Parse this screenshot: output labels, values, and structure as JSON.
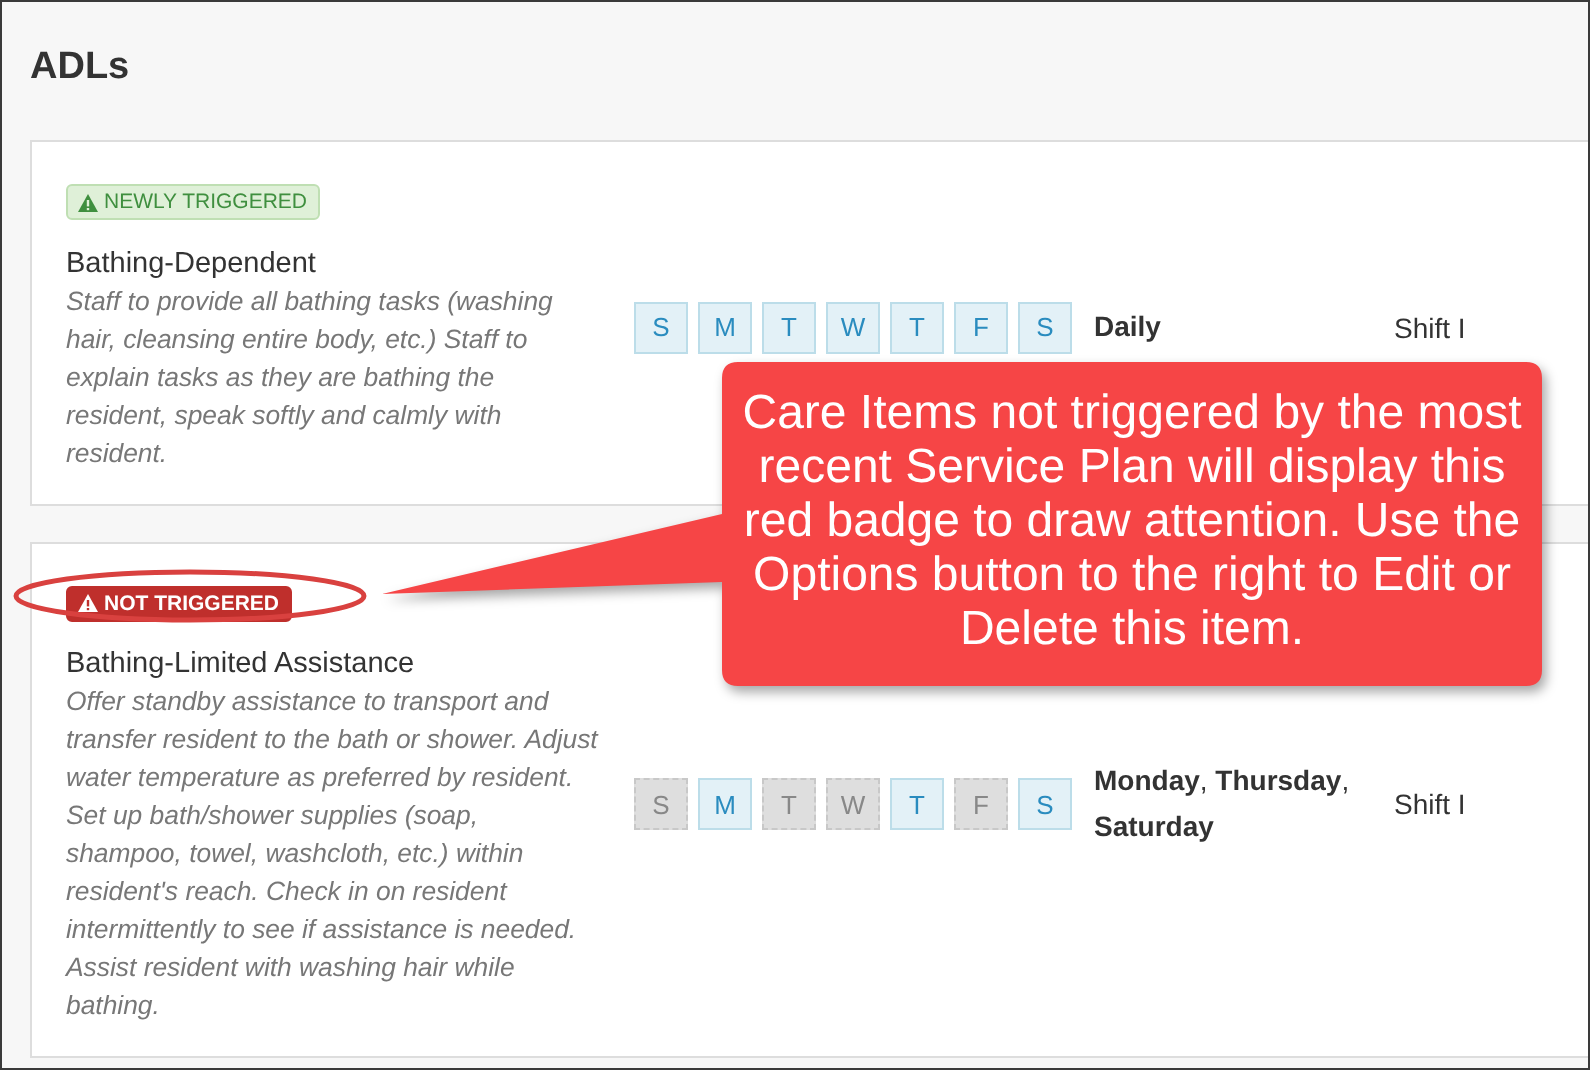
{
  "title": "ADLs",
  "care_items": [
    {
      "badge": {
        "kind": "newly_triggered",
        "label": "NEWLY TRIGGERED"
      },
      "name": "Bathing-Dependent",
      "description": "Staff to provide all bathing tasks (washing hair, cleansing entire body, etc.) Staff to explain tasks as they are bathing the resident, speak softly and calmly with resident.",
      "days": [
        {
          "label": "S",
          "selected": true
        },
        {
          "label": "M",
          "selected": true
        },
        {
          "label": "T",
          "selected": true
        },
        {
          "label": "W",
          "selected": true
        },
        {
          "label": "T",
          "selected": true
        },
        {
          "label": "F",
          "selected": true
        },
        {
          "label": "S",
          "selected": true
        }
      ],
      "frequency": "**Daily**",
      "shift": "Shift I"
    },
    {
      "badge": {
        "kind": "not_triggered",
        "label": "NOT TRIGGERED"
      },
      "name": "Bathing-Limited Assistance",
      "description": "Offer standby assistance to transport and transfer resident to the bath or shower. Adjust water temperature as preferred by resident. Set up bath/shower supplies (soap, shampoo, towel, washcloth, etc.) within resident's reach. Check in on resident intermittently to see if assistance is needed. Assist resident with washing hair while bathing.",
      "days": [
        {
          "label": "S",
          "selected": false
        },
        {
          "label": "M",
          "selected": true
        },
        {
          "label": "T",
          "selected": false
        },
        {
          "label": "W",
          "selected": false
        },
        {
          "label": "T",
          "selected": true
        },
        {
          "label": "F",
          "selected": false
        },
        {
          "label": "S",
          "selected": true
        }
      ],
      "frequency": "**Monday**, **Thursday**, **Saturday**",
      "shift": "Shift I"
    }
  ],
  "callout": {
    "text": "Care Items not triggered by the most recent Service Plan will display this red badge to draw attention. Use the Options button to the right to Edit or Delete this item."
  }
}
